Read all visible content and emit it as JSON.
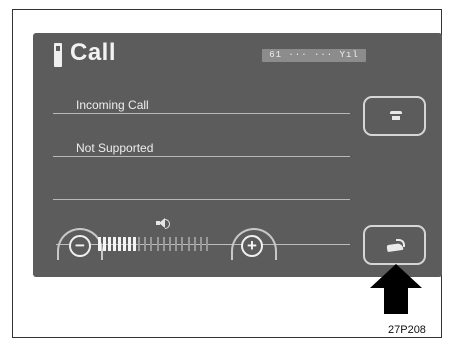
{
  "screen": {
    "title": "Call",
    "status_bar": "61 ··· ··· Yıl",
    "rows": [
      {
        "label": "Incoming Call"
      },
      {
        "label": "Not Supported"
      },
      {
        "label": ""
      }
    ]
  },
  "buttons": {
    "hold_icon": "hold-icon",
    "call_icon": "phone-icon"
  },
  "volume": {
    "minus_label": "−",
    "plus_label": "+",
    "level": 8,
    "max": 20
  },
  "caption": "27P208"
}
